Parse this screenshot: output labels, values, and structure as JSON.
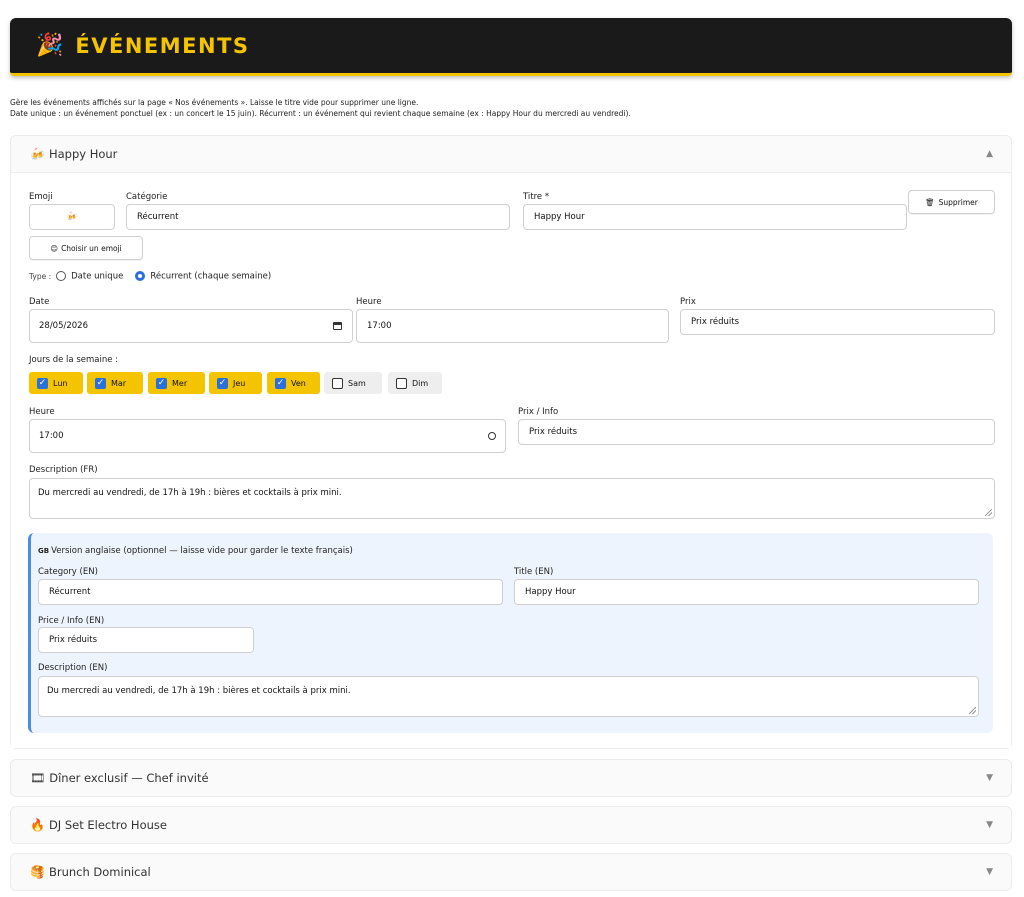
{
  "header": {
    "icon": "party-popper-icon",
    "title": "ÉVÉNEMENTS"
  },
  "intro": {
    "line1": "Gère les événements affichés sur la page « Nos événements ». Laisse le titre vide pour supprimer une ligne.",
    "line2": "Date unique : un événement ponctuel (ex : un concert le 15 juin). Récurrent : un événement qui revient chaque semaine (ex : Happy Hour du mercredi au vendredi)."
  },
  "events": [
    {
      "icon": "🍻",
      "title": "Happy Hour",
      "expanded": true
    },
    {
      "icon": "🎞",
      "title": "Dîner exclusif — Chef invité",
      "expanded": false
    },
    {
      "icon": "🔥",
      "title": "DJ Set Electro House",
      "expanded": false
    },
    {
      "icon": "🥞",
      "title": "Brunch Dominical",
      "expanded": false
    }
  ],
  "form": {
    "emoji_label": "Emoji",
    "emoji_value": "🍻",
    "choose_emoji_label": "Choisir un emoji",
    "choose_emoji_icon": "😊",
    "category_label": "Catégorie",
    "category_value": "Récurrent",
    "title_label": "Titre *",
    "title_value": "Happy Hour",
    "delete_label": "Supprimer",
    "delete_icon": "trash-icon",
    "type_label": "Type :",
    "type_options": [
      "Date unique",
      "Récurrent (chaque semaine)"
    ],
    "type_selected": "Récurrent (chaque semaine)",
    "date_label": "Date",
    "date_value": "28/05/2026",
    "time_label": "Heure",
    "time_value": "17:00",
    "price_label": "Prix",
    "price_value": "Prix réduits",
    "days_label": "Jours de la semaine :",
    "days": [
      {
        "label": "Lun",
        "checked": true
      },
      {
        "label": "Mar",
        "checked": true
      },
      {
        "label": "Mer",
        "checked": true
      },
      {
        "label": "Jeu",
        "checked": true
      },
      {
        "label": "Ven",
        "checked": true
      },
      {
        "label": "Sam",
        "checked": false
      },
      {
        "label": "Dim",
        "checked": false
      }
    ],
    "rec_time_label": "Heure",
    "rec_time_value": "17:00",
    "price_info_label": "Prix / Info",
    "price_info_value": "Prix réduits",
    "desc_label": "Description (FR)",
    "desc_value": "Du mercredi au vendredi, de 17h à 19h : bières et cocktails à prix mini."
  },
  "english": {
    "flag": "GB",
    "heading": "Version anglaise (optionnel — laisse vide pour garder le texte français)",
    "category_label": "Category (EN)",
    "category_value": "Récurrent",
    "title_label": "Title (EN)",
    "title_value": "Happy Hour",
    "price_label": "Price / Info (EN)",
    "price_value": "Prix réduits",
    "desc_label": "Description (EN)",
    "desc_value": "Du mercredi au vendredi, de 17h à 19h : bières et cocktails à prix mini."
  },
  "colors": {
    "accent": "#f5c400",
    "header_bg": "#1a1a1a",
    "radio_selected": "#2a6fdb",
    "en_border": "#4a8ee0",
    "en_bg": "#eef4fd"
  }
}
